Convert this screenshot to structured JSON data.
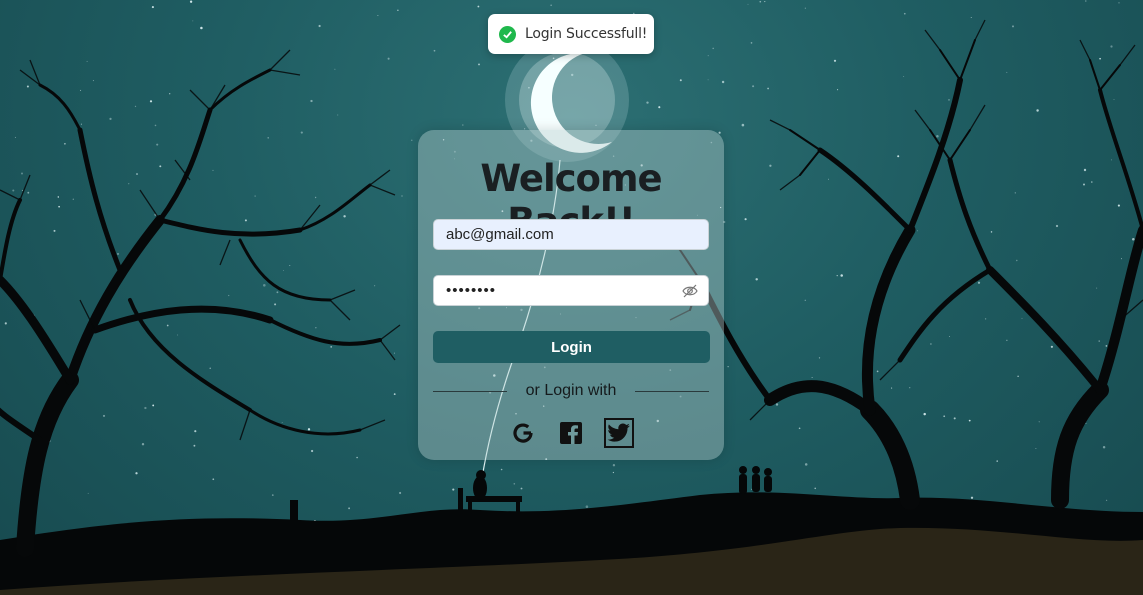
{
  "toast": {
    "message": "Login Successfull!",
    "icon": "check-circle-icon",
    "color": "#1fb84c"
  },
  "card": {
    "title": "Welcome Back!!",
    "email": {
      "value": "abc@gmail.com",
      "placeholder": ""
    },
    "password": {
      "value": "••••••••",
      "toggle_icon": "eye-slash-icon"
    },
    "login_label": "Login",
    "divider_text": "or Login with",
    "social": [
      {
        "name": "Google",
        "icon": "google-icon"
      },
      {
        "name": "Facebook",
        "icon": "facebook-icon"
      },
      {
        "name": "Twitter",
        "icon": "twitter-icon"
      }
    ]
  },
  "colors": {
    "background": "#1f5d62",
    "accent": "#1f5e63",
    "card": "#b4cdcd"
  }
}
